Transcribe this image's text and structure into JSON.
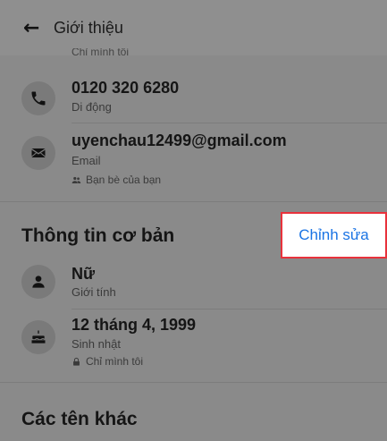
{
  "header": {
    "back_icon": "arrow-left-icon",
    "title": "Giới thiệu"
  },
  "partial_privacy": "Chỉ mình tôi",
  "contact": {
    "phone": {
      "icon": "phone-icon",
      "value": "0120 320 6280",
      "label": "Di động"
    },
    "email": {
      "icon": "envelope-icon",
      "value": "uyenchau12499@gmail.com",
      "label": "Email",
      "privacy": "Bạn bè của bạn",
      "privacy_icon": "friends-icon"
    }
  },
  "basic_info": {
    "title": "Thông tin cơ bản",
    "edit_label": "Chỉnh sửa",
    "gender": {
      "icon": "person-icon",
      "value": "Nữ",
      "label": "Giới tính"
    },
    "birthday": {
      "icon": "cake-icon",
      "value": "12 tháng 4, 1999",
      "label": "Sinh nhật",
      "privacy": "Chỉ mình tôi",
      "privacy_icon": "lock-icon"
    }
  },
  "other_names": {
    "title": "Các tên khác"
  },
  "colors": {
    "overlay": "#8a8a8a",
    "accent": "#1b74e4",
    "highlight_border": "#e8323c"
  }
}
